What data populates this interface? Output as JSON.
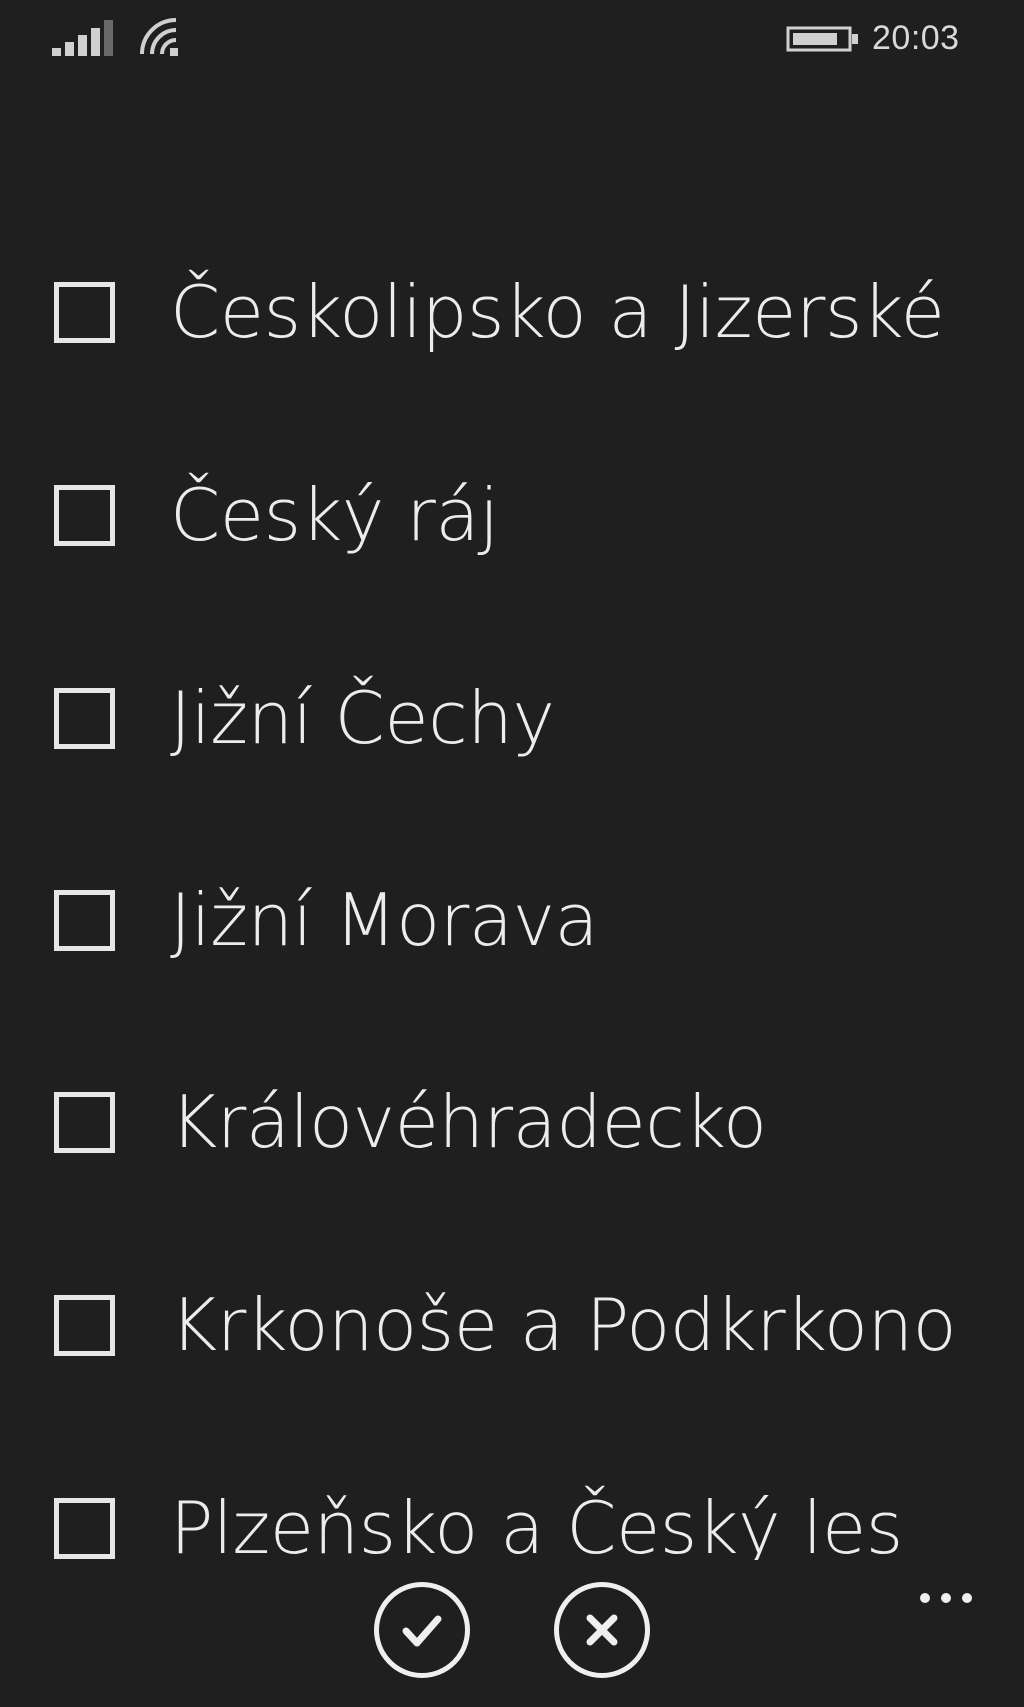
{
  "status_bar": {
    "time": "20:03",
    "icons": [
      "signal-strength-icon",
      "wifi-icon",
      "battery-icon"
    ]
  },
  "region_list": {
    "items": [
      {
        "label": "Českolipsko a Jizerské",
        "checked": false
      },
      {
        "label": "Český ráj",
        "checked": false
      },
      {
        "label": "Jižní Čechy",
        "checked": false
      },
      {
        "label": "Jižní Morava",
        "checked": false
      },
      {
        "label": "Královéhradecko",
        "checked": false
      },
      {
        "label": "Krkonoše a Podkrkono",
        "checked": false
      },
      {
        "label": "Plzeňsko a Český les",
        "checked": false
      }
    ]
  },
  "app_bar": {
    "buttons": [
      "checkmark-icon",
      "close-icon",
      "more-icon"
    ]
  },
  "colors": {
    "background": "#1f1f1f",
    "foreground": "#ececec"
  }
}
